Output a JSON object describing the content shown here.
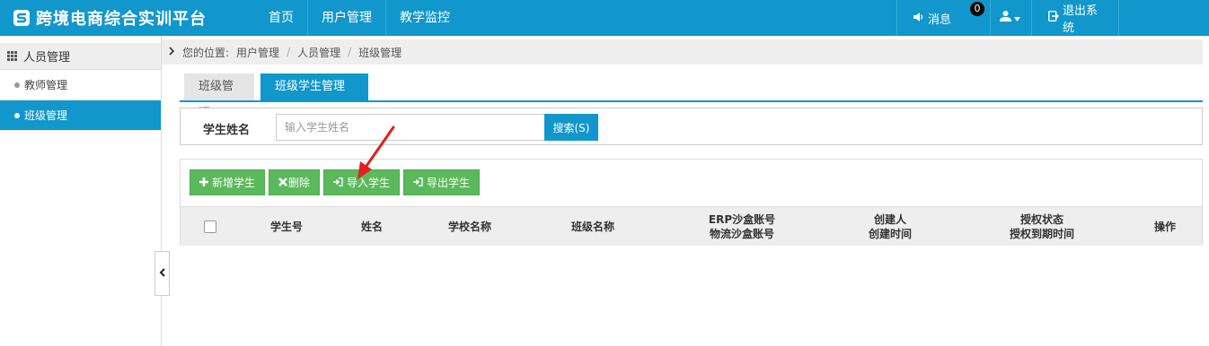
{
  "app": {
    "title": "跨境电商综合实训平台",
    "accent": "#1197cc"
  },
  "nav": {
    "items": [
      "首页",
      "用户管理",
      "教学监控"
    ]
  },
  "header_right": {
    "messages_label": "消息",
    "messages_count": "0",
    "user_icon": "user-icon",
    "logout_label": "退出系统"
  },
  "sidebar": {
    "section": "人员管理",
    "items": [
      {
        "label": "教师管理",
        "active": false
      },
      {
        "label": "班级管理",
        "active": true
      }
    ]
  },
  "breadcrumb": {
    "prefix": "您的位置:",
    "items": [
      "用户管理",
      "人员管理",
      "班级管理"
    ]
  },
  "tabs": [
    {
      "label": "班级管理"
    },
    {
      "label": "班级学生管理 ✖"
    }
  ],
  "search": {
    "label": "学生姓名",
    "placeholder": "输入学生姓名",
    "button": "搜索(S)"
  },
  "actions": [
    {
      "icon": "plus-icon",
      "label": "新增学生"
    },
    {
      "icon": "x-icon",
      "label": "删除"
    },
    {
      "icon": "import-icon",
      "label": "导入学生"
    },
    {
      "icon": "export-icon",
      "label": "导出学生"
    }
  ],
  "table": {
    "columns": [
      {
        "line1": "学生号",
        "line2": ""
      },
      {
        "line1": "姓名",
        "line2": ""
      },
      {
        "line1": "学校名称",
        "line2": ""
      },
      {
        "line1": "班级名称",
        "line2": ""
      },
      {
        "line1": "ERP沙盒账号",
        "line2": "物流沙盒账号"
      },
      {
        "line1": "创建人",
        "line2": "创建时间"
      },
      {
        "line1": "授权状态",
        "line2": "授权到期时间"
      },
      {
        "line1": "操作",
        "line2": ""
      }
    ]
  },
  "colors": {
    "green": "#5cb85c",
    "arrow": "#e02020"
  }
}
